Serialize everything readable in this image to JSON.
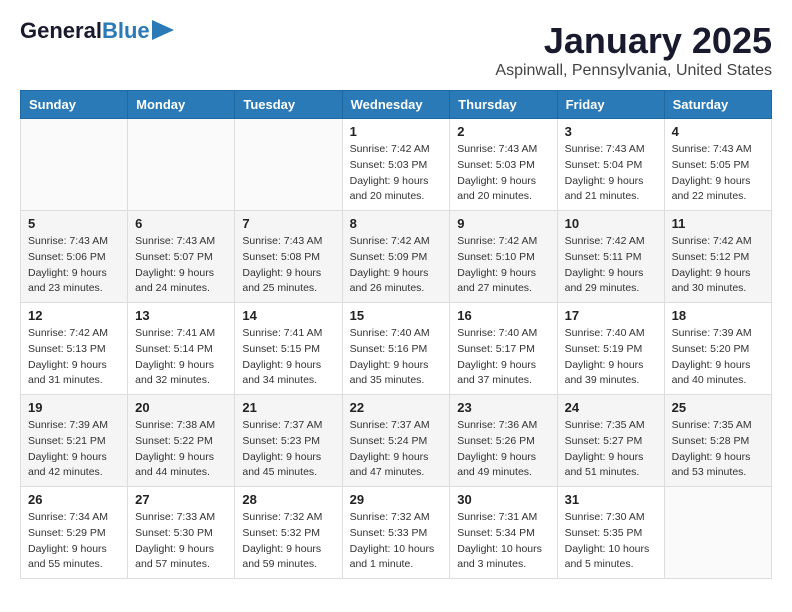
{
  "logo": {
    "text1": "General",
    "text2": "Blue"
  },
  "header": {
    "month": "January 2025",
    "location": "Aspinwall, Pennsylvania, United States"
  },
  "weekdays": [
    "Sunday",
    "Monday",
    "Tuesday",
    "Wednesday",
    "Thursday",
    "Friday",
    "Saturday"
  ],
  "weeks": [
    [
      {
        "day": "",
        "info": ""
      },
      {
        "day": "",
        "info": ""
      },
      {
        "day": "",
        "info": ""
      },
      {
        "day": "1",
        "info": "Sunrise: 7:42 AM\nSunset: 5:03 PM\nDaylight: 9 hours\nand 20 minutes."
      },
      {
        "day": "2",
        "info": "Sunrise: 7:43 AM\nSunset: 5:03 PM\nDaylight: 9 hours\nand 20 minutes."
      },
      {
        "day": "3",
        "info": "Sunrise: 7:43 AM\nSunset: 5:04 PM\nDaylight: 9 hours\nand 21 minutes."
      },
      {
        "day": "4",
        "info": "Sunrise: 7:43 AM\nSunset: 5:05 PM\nDaylight: 9 hours\nand 22 minutes."
      }
    ],
    [
      {
        "day": "5",
        "info": "Sunrise: 7:43 AM\nSunset: 5:06 PM\nDaylight: 9 hours\nand 23 minutes."
      },
      {
        "day": "6",
        "info": "Sunrise: 7:43 AM\nSunset: 5:07 PM\nDaylight: 9 hours\nand 24 minutes."
      },
      {
        "day": "7",
        "info": "Sunrise: 7:43 AM\nSunset: 5:08 PM\nDaylight: 9 hours\nand 25 minutes."
      },
      {
        "day": "8",
        "info": "Sunrise: 7:42 AM\nSunset: 5:09 PM\nDaylight: 9 hours\nand 26 minutes."
      },
      {
        "day": "9",
        "info": "Sunrise: 7:42 AM\nSunset: 5:10 PM\nDaylight: 9 hours\nand 27 minutes."
      },
      {
        "day": "10",
        "info": "Sunrise: 7:42 AM\nSunset: 5:11 PM\nDaylight: 9 hours\nand 29 minutes."
      },
      {
        "day": "11",
        "info": "Sunrise: 7:42 AM\nSunset: 5:12 PM\nDaylight: 9 hours\nand 30 minutes."
      }
    ],
    [
      {
        "day": "12",
        "info": "Sunrise: 7:42 AM\nSunset: 5:13 PM\nDaylight: 9 hours\nand 31 minutes."
      },
      {
        "day": "13",
        "info": "Sunrise: 7:41 AM\nSunset: 5:14 PM\nDaylight: 9 hours\nand 32 minutes."
      },
      {
        "day": "14",
        "info": "Sunrise: 7:41 AM\nSunset: 5:15 PM\nDaylight: 9 hours\nand 34 minutes."
      },
      {
        "day": "15",
        "info": "Sunrise: 7:40 AM\nSunset: 5:16 PM\nDaylight: 9 hours\nand 35 minutes."
      },
      {
        "day": "16",
        "info": "Sunrise: 7:40 AM\nSunset: 5:17 PM\nDaylight: 9 hours\nand 37 minutes."
      },
      {
        "day": "17",
        "info": "Sunrise: 7:40 AM\nSunset: 5:19 PM\nDaylight: 9 hours\nand 39 minutes."
      },
      {
        "day": "18",
        "info": "Sunrise: 7:39 AM\nSunset: 5:20 PM\nDaylight: 9 hours\nand 40 minutes."
      }
    ],
    [
      {
        "day": "19",
        "info": "Sunrise: 7:39 AM\nSunset: 5:21 PM\nDaylight: 9 hours\nand 42 minutes."
      },
      {
        "day": "20",
        "info": "Sunrise: 7:38 AM\nSunset: 5:22 PM\nDaylight: 9 hours\nand 44 minutes."
      },
      {
        "day": "21",
        "info": "Sunrise: 7:37 AM\nSunset: 5:23 PM\nDaylight: 9 hours\nand 45 minutes."
      },
      {
        "day": "22",
        "info": "Sunrise: 7:37 AM\nSunset: 5:24 PM\nDaylight: 9 hours\nand 47 minutes."
      },
      {
        "day": "23",
        "info": "Sunrise: 7:36 AM\nSunset: 5:26 PM\nDaylight: 9 hours\nand 49 minutes."
      },
      {
        "day": "24",
        "info": "Sunrise: 7:35 AM\nSunset: 5:27 PM\nDaylight: 9 hours\nand 51 minutes."
      },
      {
        "day": "25",
        "info": "Sunrise: 7:35 AM\nSunset: 5:28 PM\nDaylight: 9 hours\nand 53 minutes."
      }
    ],
    [
      {
        "day": "26",
        "info": "Sunrise: 7:34 AM\nSunset: 5:29 PM\nDaylight: 9 hours\nand 55 minutes."
      },
      {
        "day": "27",
        "info": "Sunrise: 7:33 AM\nSunset: 5:30 PM\nDaylight: 9 hours\nand 57 minutes."
      },
      {
        "day": "28",
        "info": "Sunrise: 7:32 AM\nSunset: 5:32 PM\nDaylight: 9 hours\nand 59 minutes."
      },
      {
        "day": "29",
        "info": "Sunrise: 7:32 AM\nSunset: 5:33 PM\nDaylight: 10 hours\nand 1 minute."
      },
      {
        "day": "30",
        "info": "Sunrise: 7:31 AM\nSunset: 5:34 PM\nDaylight: 10 hours\nand 3 minutes."
      },
      {
        "day": "31",
        "info": "Sunrise: 7:30 AM\nSunset: 5:35 PM\nDaylight: 10 hours\nand 5 minutes."
      },
      {
        "day": "",
        "info": ""
      }
    ]
  ]
}
